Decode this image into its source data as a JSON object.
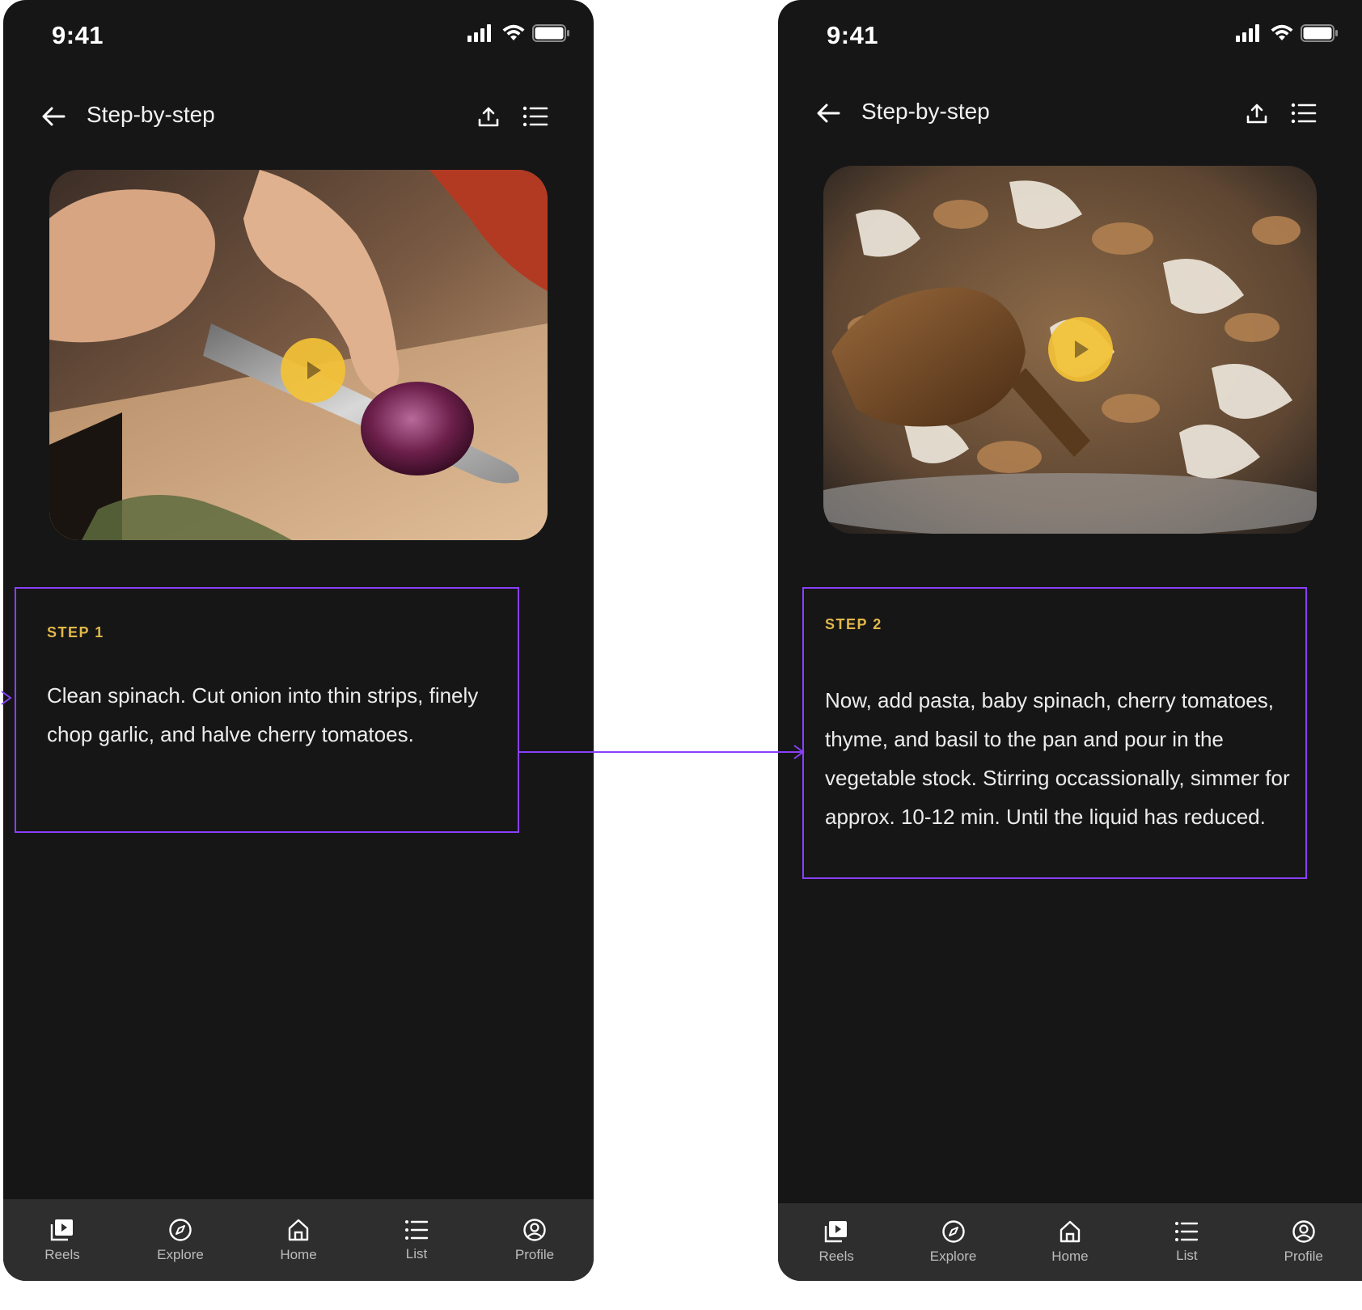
{
  "colors": {
    "background": "#161616",
    "accent_play": "#f3c237",
    "step_label": "#e2b84a",
    "annotation": "#8a3ffc",
    "tab_bar": "#2e2e2e"
  },
  "screens": [
    {
      "status": {
        "time": "9:41"
      },
      "header": {
        "title": "Step-by-step",
        "back_icon": "arrow-left-icon",
        "share_icon": "share-upload-icon",
        "list_icon": "list-icon"
      },
      "media": {
        "description_icon": "play-icon"
      },
      "step": {
        "label": "STEP 1",
        "text": "Clean spinach. Cut onion into thin strips, finely chop garlic, and halve cherry tomatoes."
      }
    },
    {
      "status": {
        "time": "9:41"
      },
      "header": {
        "title": "Step-by-step",
        "back_icon": "arrow-left-icon",
        "share_icon": "share-upload-icon",
        "list_icon": "list-icon"
      },
      "media": {
        "description_icon": "play-icon"
      },
      "step": {
        "label": "STEP 2",
        "text": "Now, add pasta, baby spinach, cherry tomatoes, thyme, and basil to the pan and pour in the vegetable stock. Stirring occassionally, simmer for approx. 10-12 min. Until the liquid has reduced."
      }
    }
  ],
  "tabs": [
    {
      "label": "Reels",
      "icon": "reels-icon"
    },
    {
      "label": "Explore",
      "icon": "compass-icon"
    },
    {
      "label": "Home",
      "icon": "home-icon"
    },
    {
      "label": "List",
      "icon": "list-icon"
    },
    {
      "label": "Profile",
      "icon": "profile-icon"
    }
  ]
}
